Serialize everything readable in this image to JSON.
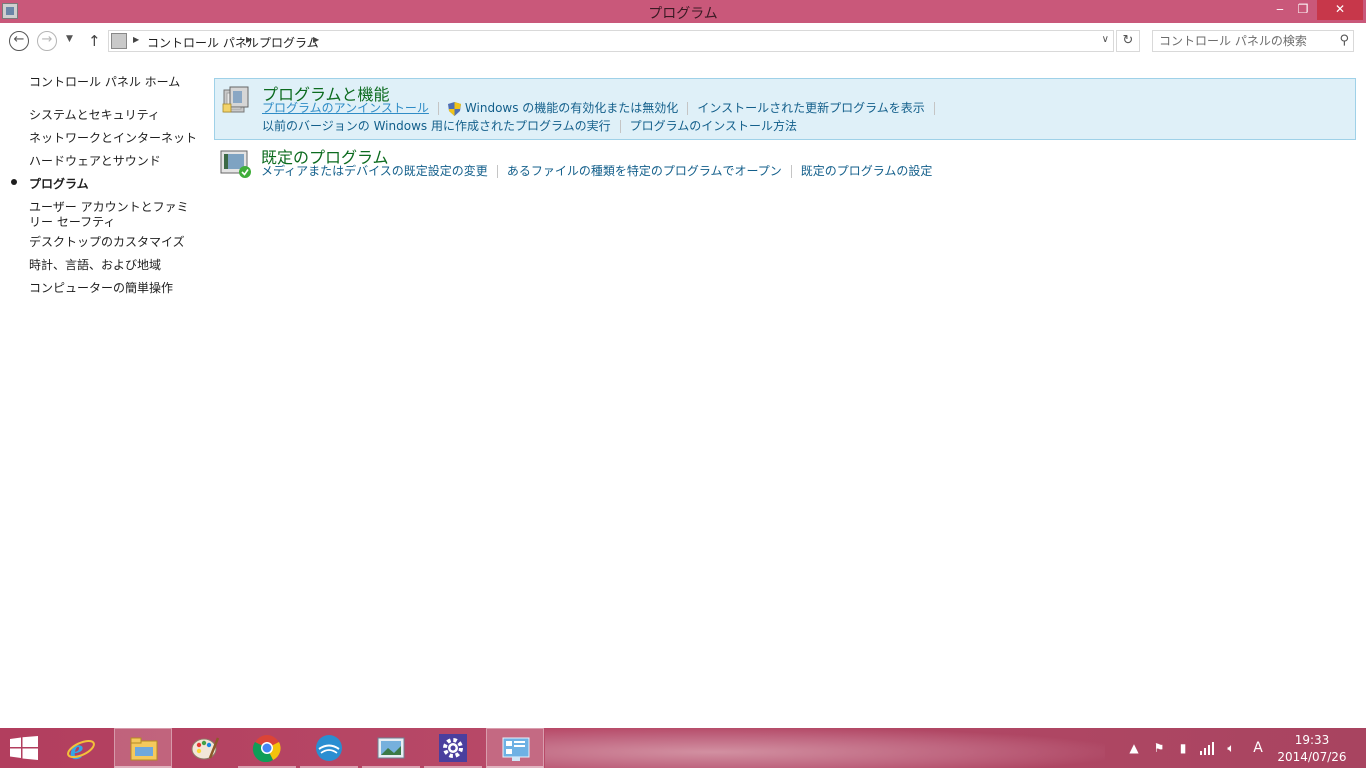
{
  "window": {
    "title": "プログラム",
    "minimize_label": "‒",
    "maximize_label": "❐",
    "close_label": "✕"
  },
  "nav": {
    "back_icon": "left-arrow",
    "forward_icon": "right-arrow",
    "up_icon": "up-arrow",
    "breadcrumb": [
      "コントロール パネル",
      "プログラム"
    ],
    "search_placeholder": "コントロール パネルの検索"
  },
  "left_pane": {
    "home": "コントロール パネル ホーム",
    "items": [
      {
        "label": "システムとセキュリティ"
      },
      {
        "label": "ネットワークとインターネット"
      },
      {
        "label": "ハードウェアとサウンド"
      },
      {
        "label": "プログラム",
        "current": true
      },
      {
        "label": "ユーザー アカウントとファミリー セーフティ"
      },
      {
        "label": "デスクトップのカスタマイズ"
      },
      {
        "label": "時計、言語、および地域"
      },
      {
        "label": "コンピューターの簡単操作"
      }
    ]
  },
  "categories": [
    {
      "title": "プログラムと機能",
      "icon": "programs-features-icon",
      "links_row1": [
        "プログラムのアンインストール",
        "Windows の機能の有効化または無効化",
        "インストールされた更新プログラムを表示"
      ],
      "links_row2": [
        "以前のバージョンの Windows 用に作成されたプログラムの実行",
        "プログラムのインストール方法"
      ]
    },
    {
      "title": "既定のプログラム",
      "icon": "default-programs-icon",
      "links_row1": [
        "メディアまたはデバイスの既定設定の変更",
        "あるファイルの種類を特定のプログラムでオープン",
        "既定のプログラムの設定"
      ]
    }
  ],
  "taskbar": {
    "items": [
      "internet-explorer",
      "file-explorer",
      "paint",
      "chrome",
      "wing-app",
      "photo-viewer",
      "settings",
      "control-panel"
    ],
    "tray_ime": "A",
    "clock_time": "19:33",
    "clock_date": "2014/07/26"
  },
  "colors": {
    "titlebar": "#c9587a",
    "taskbar": "#b23e5e",
    "category_title": "#0c6b1f",
    "link": "#135f8b",
    "highlight_bg": "#dff0f8"
  }
}
